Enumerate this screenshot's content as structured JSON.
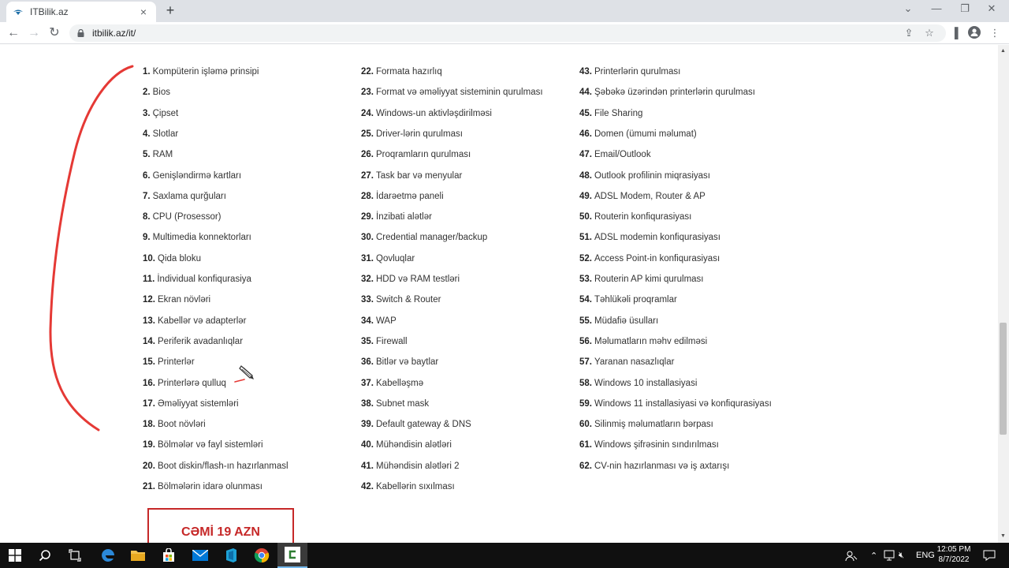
{
  "browser": {
    "tab_title": "ITBilik.az",
    "url": "itbilik.az/it/",
    "new_tab": "+",
    "tab_close": "×"
  },
  "course_list": {
    "column1": [
      {
        "num": "1.",
        "text": "Kompüterin işləmə prinsipi"
      },
      {
        "num": "2.",
        "text": "Bios"
      },
      {
        "num": "3.",
        "text": "Çipset"
      },
      {
        "num": "4.",
        "text": "Slotlar"
      },
      {
        "num": "5.",
        "text": "RAM"
      },
      {
        "num": "6.",
        "text": "Genişləndirmə kartları"
      },
      {
        "num": "7.",
        "text": "Saxlama qurğuları"
      },
      {
        "num": "8.",
        "text": "CPU (Prosessor)"
      },
      {
        "num": "9.",
        "text": "Multimedia konnektorları"
      },
      {
        "num": "10.",
        "text": "Qida bloku"
      },
      {
        "num": "11.",
        "text": "İndividual konfiqurasiya"
      },
      {
        "num": "12.",
        "text": "Ekran növləri"
      },
      {
        "num": "13.",
        "text": "Kabellər və adapterlər"
      },
      {
        "num": "14.",
        "text": "Periferik avadanlıqlar"
      },
      {
        "num": "15.",
        "text": "Printerlər"
      },
      {
        "num": "16.",
        "text": "Printerlərə qulluq"
      },
      {
        "num": "17.",
        "text": "Əməliyyat sistemləri"
      },
      {
        "num": "18.",
        "text": "Boot növləri"
      },
      {
        "num": "19.",
        "text": "Bölmələr və fayl sistemləri"
      },
      {
        "num": "20.",
        "text": "Boot diskin/flash-ın hazırlanmasl"
      },
      {
        "num": "21.",
        "text": "Bölmələrin idarə olunması"
      }
    ],
    "column2": [
      {
        "num": "22.",
        "text": "Formata hazırlıq"
      },
      {
        "num": "23.",
        "text": "Format və əməliyyat sisteminin qurulması"
      },
      {
        "num": "24.",
        "text": "Windows-un aktivləşdirilməsi"
      },
      {
        "num": "25.",
        "text": "Driver-lərin qurulması"
      },
      {
        "num": "26.",
        "text": "Proqramların qurulması"
      },
      {
        "num": "27.",
        "text": "Task bar və menyular"
      },
      {
        "num": "28.",
        "text": "İdarəetmə paneli"
      },
      {
        "num": "29.",
        "text": "İnzibati alətlər"
      },
      {
        "num": "30.",
        "text": "Credential manager/backup"
      },
      {
        "num": "31.",
        "text": "Qovluqlar"
      },
      {
        "num": "32.",
        "text": "HDD və RAM testləri"
      },
      {
        "num": "33.",
        "text": "Switch & Router"
      },
      {
        "num": "34.",
        "text": "WAP"
      },
      {
        "num": "35.",
        "text": "Firewall"
      },
      {
        "num": "36.",
        "text": "Bitlər və baytlar"
      },
      {
        "num": "37.",
        "text": "Kabelləşmə"
      },
      {
        "num": "38.",
        "text": "Subnet mask"
      },
      {
        "num": "39.",
        "text": "Default gateway & DNS"
      },
      {
        "num": "40.",
        "text": "Mühəndisin alətləri"
      },
      {
        "num": "41.",
        "text": "Mühəndisin alətləri 2"
      },
      {
        "num": "42.",
        "text": "Kabellərin sıxılması"
      }
    ],
    "column3": [
      {
        "num": "43.",
        "text": "Printerlərin qurulması"
      },
      {
        "num": "44.",
        "text": "Şəbəkə üzərindən printerlərin qurulması"
      },
      {
        "num": "45.",
        "text": "File Sharing"
      },
      {
        "num": "46.",
        "text": "Domen (ümumi məlumat)"
      },
      {
        "num": "47.",
        "text": "Email/Outlook"
      },
      {
        "num": "48.",
        "text": "Outlook profilinin miqrasiyası"
      },
      {
        "num": "49.",
        "text": "ADSL Modem, Router & AP"
      },
      {
        "num": "50.",
        "text": "Routerin konfiqurasiyası"
      },
      {
        "num": "51.",
        "text": "ADSL modemin konfiqurasiyası"
      },
      {
        "num": "52.",
        "text": "Access Point-in konfiqurasiyası"
      },
      {
        "num": "53.",
        "text": "Routerin AP kimi qurulması"
      },
      {
        "num": "54.",
        "text": "Təhlükəli proqramlar"
      },
      {
        "num": "55.",
        "text": "Müdafiə üsulları"
      },
      {
        "num": "56.",
        "text": "Məlumatların məhv edilməsi"
      },
      {
        "num": "57.",
        "text": "Yaranan nasazlıqlar"
      },
      {
        "num": "58.",
        "text": "Windows 10 installasiyasi"
      },
      {
        "num": "59.",
        "text": "Windows 11 installasiyasi və konfiqurasiyası"
      },
      {
        "num": "60.",
        "text": "Silinmiş məlumatların bərpası"
      },
      {
        "num": "61.",
        "text": "Windows şifrəsinin sındırılması"
      },
      {
        "num": "62.",
        "text": "CV-nin hazırlanması və iş axtarışı"
      }
    ]
  },
  "price_box": {
    "label": "CƏMİ 19 AZN",
    "color": "#c62828"
  },
  "annotation_color": "#e53935",
  "taskbar": {
    "language": "ENG",
    "time": "12:05 PM",
    "date": "8/7/2022"
  }
}
